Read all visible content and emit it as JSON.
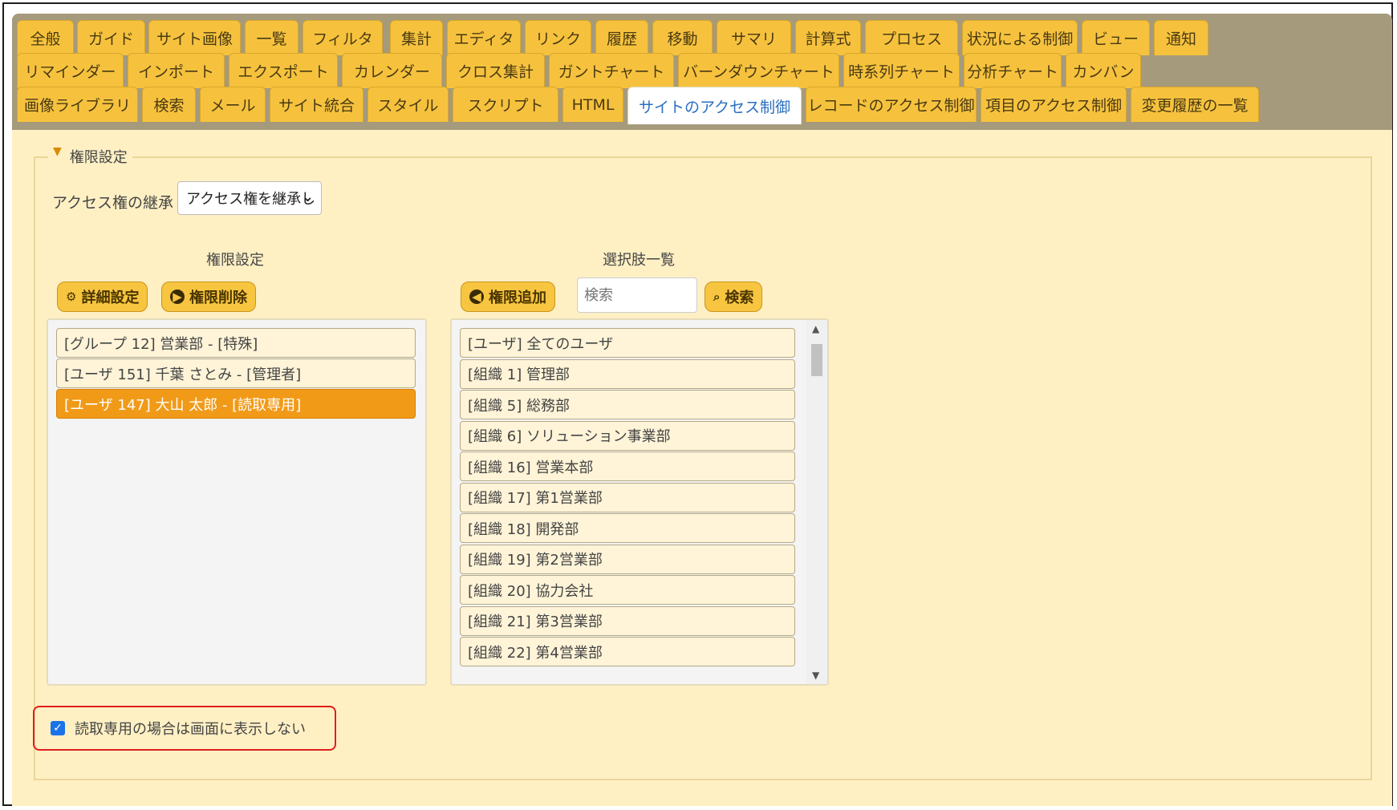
{
  "tabs": {
    "row1": [
      "全般",
      "ガイド",
      "サイト画像",
      "一覧",
      "フィルタ",
      "集計",
      "エディタ",
      "リンク",
      "履歴",
      "移動",
      "サマリ",
      "計算式",
      "プロセス",
      "状況による制御",
      "ビュー",
      "通知"
    ],
    "row2": [
      "リマインダー",
      "インポート",
      "エクスポート",
      "カレンダー",
      "クロス集計",
      "ガントチャート",
      "バーンダウンチャート",
      "時系列チャート",
      "分析チャート",
      "カンバン"
    ],
    "row3": [
      "画像ライブラリ",
      "検索",
      "メール",
      "サイト統合",
      "スタイル",
      "スクリプト",
      "HTML",
      "サイトのアクセス制御",
      "レコードのアクセス制御",
      "項目のアクセス制御",
      "変更履歴の一覧"
    ],
    "active": "サイトのアクセス制御"
  },
  "permissions": {
    "legend": "権限設定",
    "inherit_label": "アクセス権の継承",
    "inherit_value": "アクセス権を継承し",
    "current_title": "権限設定",
    "choices_title": "選択肢一覧",
    "buttons": {
      "advanced": "詳細設定",
      "remove": "権限削除",
      "add": "権限追加",
      "search": "検索"
    },
    "search_placeholder": "検索",
    "current_items": [
      "[グループ 12] 営業部 - [特殊]",
      "[ユーザ 151] 千葉 さとみ - [管理者]",
      "[ユーザ 147] 大山 太郎 - [読取専用]"
    ],
    "selected_item": "[ユーザ 147] 大山 太郎 - [読取専用]",
    "choice_items": [
      "[ユーザ] 全てのユーザ",
      "[組織 1] 管理部",
      "[組織 5] 総務部",
      "[組織 6] ソリューション事業部",
      "[組織 16] 営業本部",
      "[組織 17] 第1営業部",
      "[組織 18] 開発部",
      "[組織 19] 第2営業部",
      "[組織 20] 協力会社",
      "[組織 21] 第3営業部",
      "[組織 22] 第4営業部"
    ],
    "hide_readonly_label": "読取専用の場合は画面に表示しない",
    "hide_readonly_checked": true
  },
  "colors": {
    "tab": "#f6c23e",
    "content_bg": "#fff0c4",
    "selected": "#f19a18",
    "highlight_border": "#e01d1d"
  }
}
